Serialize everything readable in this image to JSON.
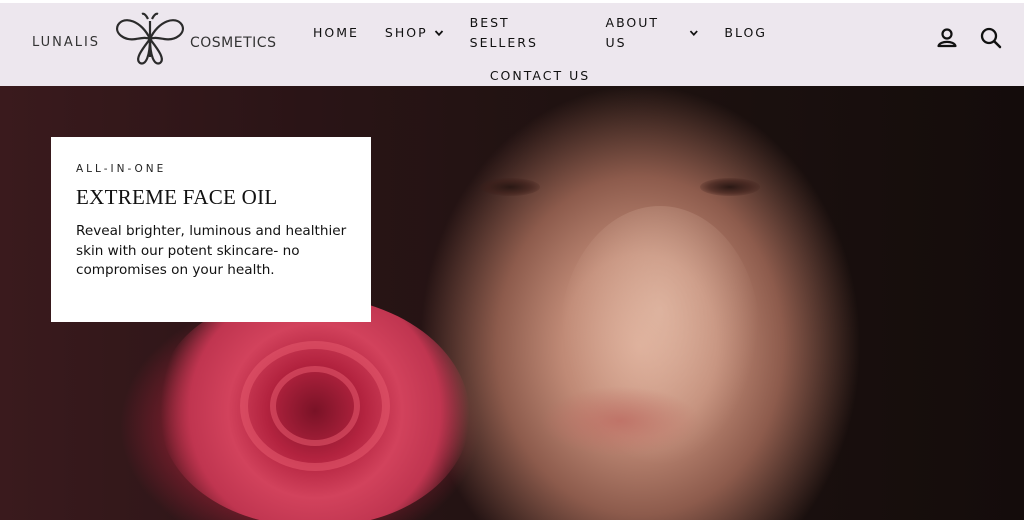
{
  "brand": {
    "left": "LUNALIS",
    "right": "COSMETICS",
    "mark": "butterfly-logo"
  },
  "nav": {
    "row1": [
      {
        "label": "HOME",
        "dropdown": false
      },
      {
        "label": "SHOP",
        "dropdown": true
      },
      {
        "label": "BEST SELLERS",
        "dropdown": false
      },
      {
        "label": "ABOUT US",
        "dropdown": true
      },
      {
        "label": "BLOG",
        "dropdown": false
      }
    ],
    "row2": [
      {
        "label": "CONTACT US",
        "dropdown": false
      }
    ]
  },
  "header_icons": {
    "account": "account-icon",
    "search": "search-icon"
  },
  "hero": {
    "eyebrow": "ALL-IN-ONE",
    "title": "EXTREME FACE OIL",
    "body": "Reveal brighter, luminous and healthier skin with our potent skincare- no compromises on your health."
  },
  "colors": {
    "header_bg": "#ede7ee",
    "card_bg": "#ffffff",
    "text": "#111111"
  }
}
